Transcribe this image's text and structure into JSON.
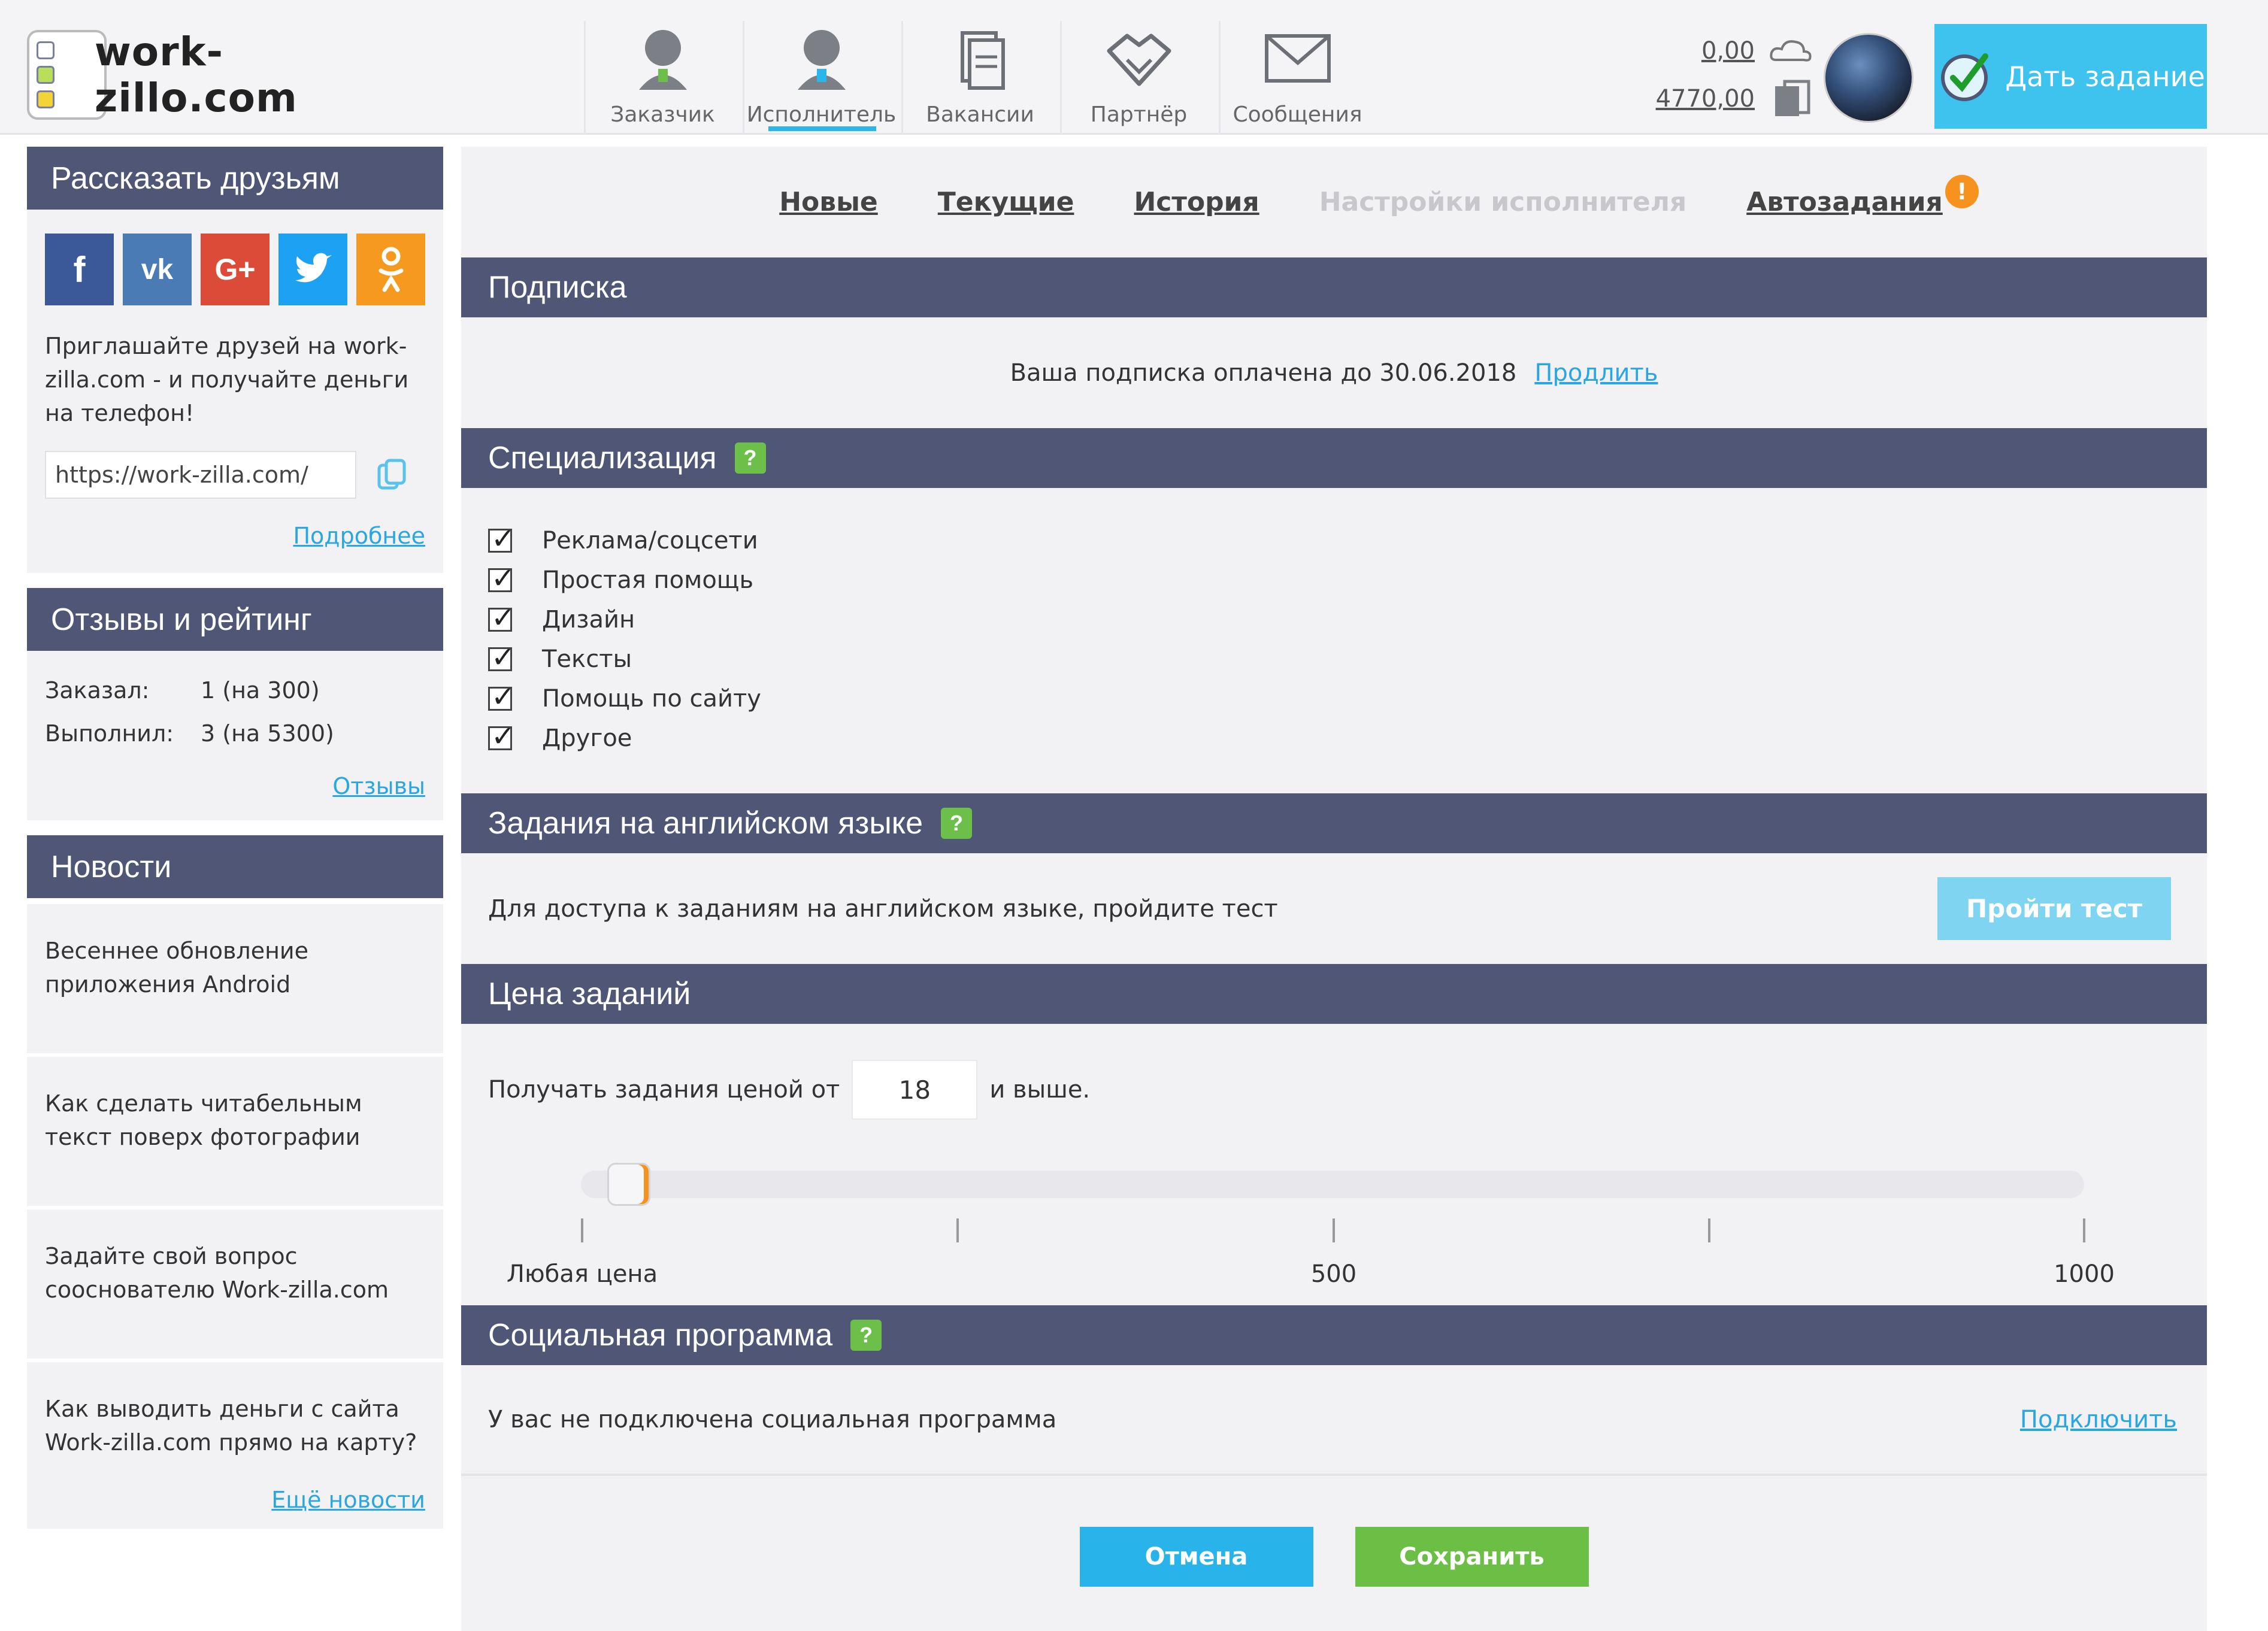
{
  "header": {
    "logo_text": "work-zillo.com",
    "nav": [
      {
        "label": "Заказчик",
        "icon": "customer-icon"
      },
      {
        "label": "Исполнитель",
        "icon": "performer-icon",
        "active": true
      },
      {
        "label": "Вакансии",
        "icon": "vacancies-icon"
      },
      {
        "label": "Партнёр",
        "icon": "partner-icon"
      },
      {
        "label": "Сообщения",
        "icon": "messages-icon"
      }
    ],
    "balance_1": "0,00",
    "balance_2": "4770,00",
    "give_task_label": "Дать задание"
  },
  "sidebar": {
    "share": {
      "title": "Рассказать друзьям",
      "socials": [
        "f",
        "vk",
        "G+",
        "twitter",
        "ok"
      ],
      "text": "Приглашайте друзей на work-zilla.com - и получайте деньги на телефон!",
      "ref_url": "https://work-zilla.com/",
      "more_link": "Подробнее"
    },
    "rating": {
      "title": "Отзывы и рейтинг",
      "rows": [
        {
          "label": "Заказал:",
          "value": "1 (на 300)"
        },
        {
          "label": "Выполнил:",
          "value": "3 (на 5300)"
        }
      ],
      "link": "Отзывы"
    },
    "news": {
      "title": "Новости",
      "items": [
        "Весеннее обновление приложения Android",
        "Как сделать читабельным текст поверх фотографии",
        "Задайте свой вопрос сооснователю Work-zilla.com",
        "Как выводить деньги с сайта Work-zilla.com прямо на карту?"
      ],
      "more_link": "Ещё новости"
    }
  },
  "main": {
    "tabs": [
      {
        "label": "Новые"
      },
      {
        "label": "Текущие"
      },
      {
        "label": "История"
      },
      {
        "label": "Настройки исполнителя",
        "disabled": true
      },
      {
        "label": "Автозадания",
        "badge": "!"
      }
    ],
    "subscription": {
      "title": "Подписка",
      "text": "Ваша подписка оплачена до 30.06.2018",
      "link": "Продлить"
    },
    "specialization": {
      "title": "Специализация",
      "help": "?",
      "items": [
        "Реклама/соцсети",
        "Простая помощь",
        "Дизайн",
        "Тексты",
        "Помощь по сайту",
        "Другое"
      ]
    },
    "english": {
      "title": "Задания на английском языке",
      "help": "?",
      "text": "Для доступа к заданиям на английском языке, пройдите тест",
      "button": "Пройти тест"
    },
    "price": {
      "title": "Цена заданий",
      "prefix": "Получать задания ценой от",
      "value": "18",
      "suffix": "и выше.",
      "slider_value": 18,
      "slider_max": 1000,
      "tick_labels": [
        "Любая цена",
        "500",
        "1000"
      ]
    },
    "social": {
      "title": "Социальная программа",
      "help": "?",
      "text": "У вас не подключена социальная программа",
      "link": "Подключить"
    },
    "actions": {
      "cancel": "Отмена",
      "save": "Сохранить"
    }
  },
  "colors": {
    "section_header": "#4f5676",
    "accent_blue": "#28b4ea",
    "accent_green": "#6bbf44",
    "badge_orange": "#f7921e",
    "panel_bg": "#f2f2f4"
  }
}
